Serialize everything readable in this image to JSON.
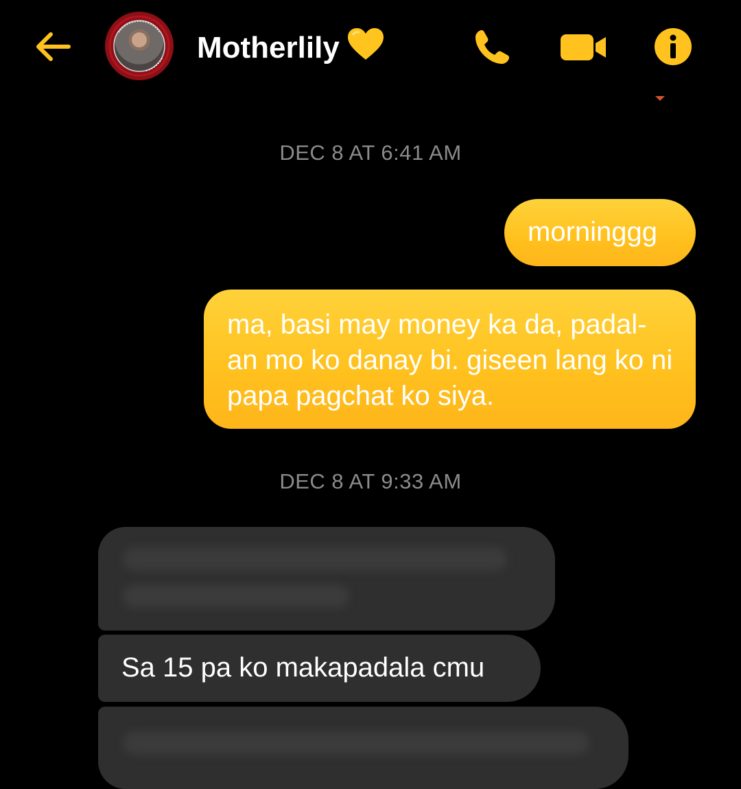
{
  "header": {
    "contact_name": "Motherlily",
    "name_emoji": "yellow-heart",
    "avatar_label": "Avatar of Motherlily",
    "icons": {
      "back": "back-arrow-icon",
      "call": "phone-icon",
      "video": "video-camera-icon",
      "info": "info-icon"
    },
    "accent_color": "#ffc21f"
  },
  "conversation": {
    "timestamps": [
      "DEC 8 AT 6:41 AM",
      "DEC 8 AT 9:33 AM"
    ],
    "outgoing": [
      {
        "text": "morninggg"
      },
      {
        "text": "ma, basi may money ka da, padal-an mo ko danay bi. giseen lang ko ni papa pagchat ko siya."
      }
    ],
    "incoming": [
      {
        "text": ""
      },
      {
        "text": "Sa 15 pa ko makapadala cmu"
      },
      {
        "text": ""
      }
    ],
    "colors": {
      "outgoing_bubble": "#ffc21f",
      "incoming_bubble": "#2f2f2f",
      "timestamp_text": "#8b8b8b",
      "background": "#000000"
    }
  }
}
